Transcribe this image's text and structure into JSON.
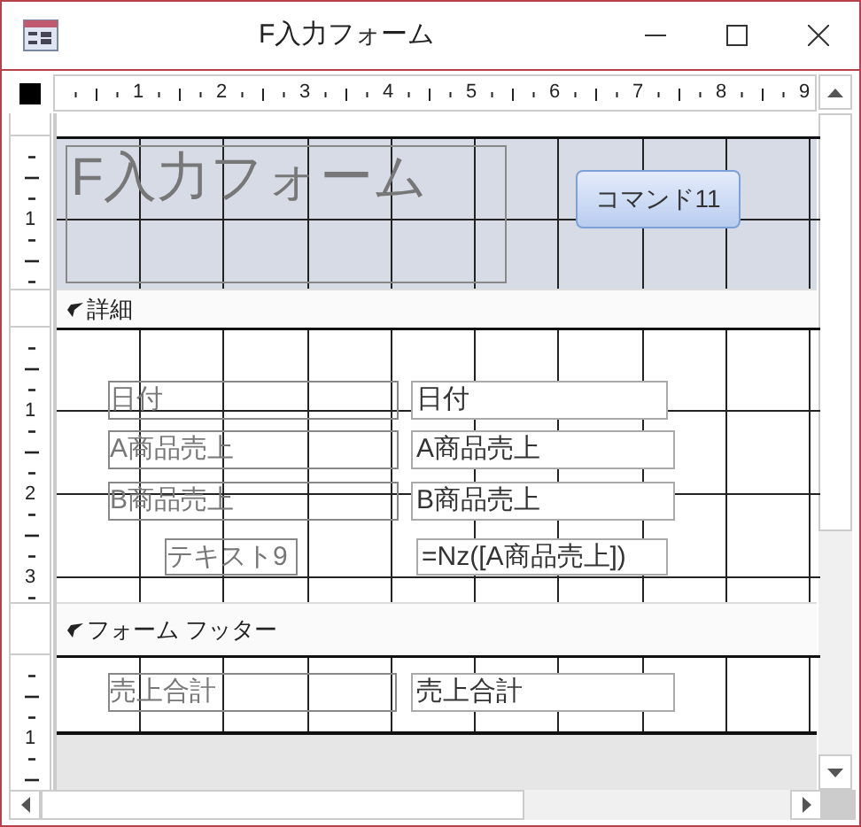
{
  "window": {
    "title": "F入力フォーム"
  },
  "ruler": {
    "numbers": [
      "1",
      "2",
      "3",
      "4",
      "5",
      "6",
      "7",
      "8",
      "9"
    ]
  },
  "sections": [
    {
      "kind": "header",
      "ruler_numbers": [
        "1"
      ],
      "controls": [
        {
          "kind": "title",
          "text": "F入力フォーム"
        },
        {
          "kind": "button",
          "text": "コマンド11"
        }
      ]
    },
    {
      "kind": "detail",
      "bar": "詳細",
      "ruler_numbers": [
        "1",
        "2",
        "3"
      ],
      "controls": [
        {
          "kind": "label",
          "text": "日付"
        },
        {
          "kind": "textbox",
          "text": "日付"
        },
        {
          "kind": "label",
          "text": "A商品売上"
        },
        {
          "kind": "textbox",
          "text": "A商品売上"
        },
        {
          "kind": "label",
          "text": "B商品売上"
        },
        {
          "kind": "textbox",
          "text": "B商品売上"
        },
        {
          "kind": "label",
          "text": "テキスト9"
        },
        {
          "kind": "textbox",
          "text": "=Nz([A商品売上])"
        }
      ]
    },
    {
      "kind": "footer",
      "bar": "フォーム フッター",
      "ruler_numbers": [
        "1"
      ],
      "controls": [
        {
          "kind": "label",
          "text": "売上合計"
        },
        {
          "kind": "textbox",
          "text": "売上合計"
        }
      ]
    }
  ]
}
